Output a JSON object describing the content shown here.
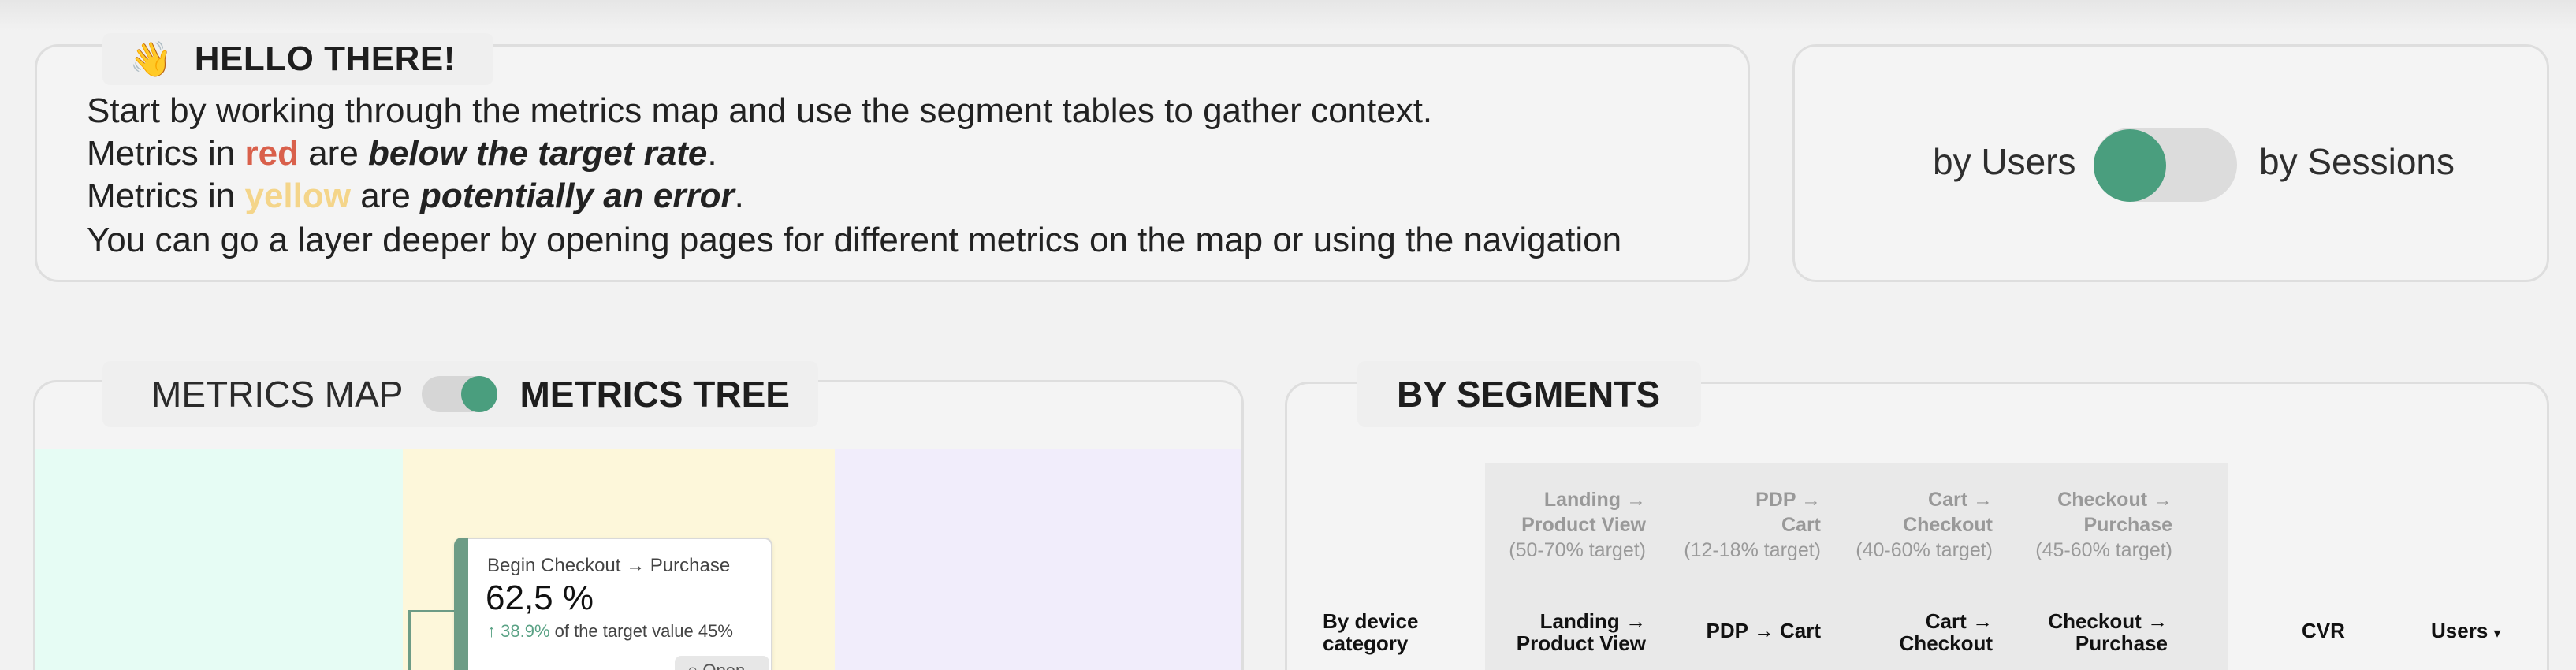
{
  "hello": {
    "emoji": "👋",
    "title": "HELLO THERE!",
    "line1": "Start by working through the metrics map and use the segment tables to gather context.",
    "line2_prefix": "Metrics in ",
    "line2_color": "red",
    "line2_mid": " are ",
    "line2_bold": "below the target rate",
    "line2_end": ".",
    "line3_prefix": "Metrics in ",
    "line3_color": "yellow",
    "line3_mid": " are ",
    "line3_bold": "potentially an error",
    "line3_end": ".",
    "line4": "You can go a layer deeper by opening pages for different metrics on the map or using the navigation"
  },
  "mode_toggle": {
    "left_label": "by Users",
    "right_label": "by Sessions",
    "state": "by Users"
  },
  "metrics": {
    "map_label": "METRICS MAP",
    "tree_label": "METRICS TREE",
    "active": "METRICS TREE",
    "node": {
      "title": "Begin Checkout → Purchase",
      "value": "62,5 %",
      "change": "38.9%",
      "change_suffix": " of the target value 45%",
      "open_label": "Open",
      "arrow": "↑"
    }
  },
  "segments": {
    "title": "BY SEGMENTS",
    "target_headers": [
      {
        "l1": "Landing →",
        "l2": "Product View",
        "target": "(50-70% target)"
      },
      {
        "l1": "PDP →",
        "l2": "Cart",
        "target": "(12-18% target)"
      },
      {
        "l1": "Cart →",
        "l2": "Checkout",
        "target": "(40-60% target)"
      },
      {
        "l1": "Checkout →",
        "l2": "Purchase",
        "target": "(45-60% target)"
      }
    ],
    "row_label_l1": "By device",
    "row_label_l2": "category",
    "columns": [
      {
        "l1": "Landing →",
        "l2": "Product View"
      },
      {
        "l1": "PDP → Cart",
        "l2": ""
      },
      {
        "l1": "Cart →",
        "l2": "Checkout"
      },
      {
        "l1": "Checkout →",
        "l2": "Purchase"
      }
    ],
    "cvr_label": "CVR",
    "users_label": "Users",
    "sort_icon": "▾"
  },
  "colors": {
    "accent_green": "#4a9e7e",
    "red": "#d9604b",
    "yellow": "#f4d58a"
  }
}
